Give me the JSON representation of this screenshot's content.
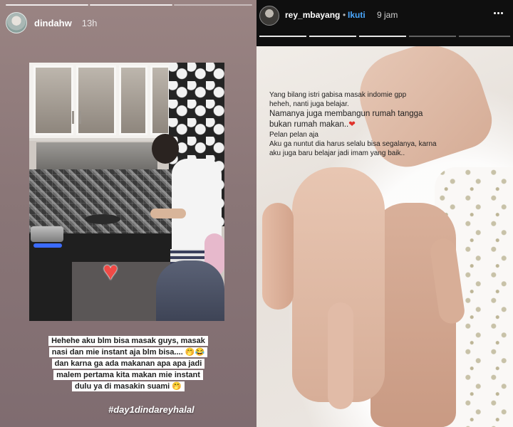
{
  "left_story": {
    "username": "dindahw",
    "time": "13h",
    "caption_lines": [
      "Hehehe aku blm bisa masak guys, masak",
      "nasi dan mie instant aja blm bisa....",
      "dan karna ga ada makanan apa apa jadi",
      "malem pertama kita makan mie instant",
      "dulu ya di masakin suami"
    ],
    "emoji_after_line2": "🤭😂",
    "emoji_after_line5": "🤭",
    "hashtag": "#day1dindareyhalal",
    "heart_sticker": "♥"
  },
  "right_story": {
    "username": "rey_mbayang",
    "dot": "•",
    "follow_label": "Ikuti",
    "time": "9 jam",
    "caption": {
      "line1": "Yang bilang istri gabisa masak indomie gpp",
      "line2": "heheh, nanti juga belajar.",
      "line3": "Namanya juga membangun rumah tangga",
      "line4a": "bukan rumah makan..",
      "line4_heart": "❤",
      "line5": "Pelan pelan aja",
      "line6": "Aku ga nuntut dia harus selalu bisa segalanya, karna",
      "line7": "aku juga baru belajar jadi imam yang baik.."
    }
  },
  "colors": {
    "follow_blue": "#4aa8ff",
    "heart_red": "#f04a46"
  }
}
